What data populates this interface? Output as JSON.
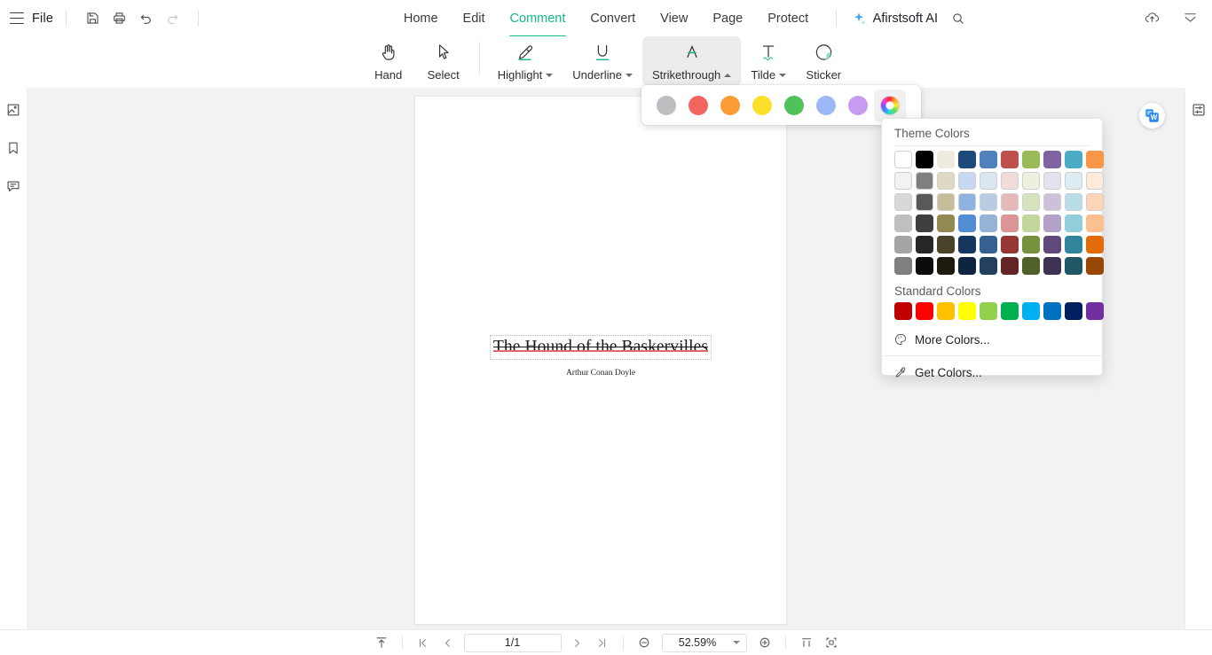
{
  "app": {
    "brand": "Afirstsoft AI",
    "file_menu": "File"
  },
  "menubar": {
    "tabs": [
      {
        "label": "Home",
        "active": false
      },
      {
        "label": "Edit",
        "active": false
      },
      {
        "label": "Comment",
        "active": true
      },
      {
        "label": "Convert",
        "active": false
      },
      {
        "label": "View",
        "active": false
      },
      {
        "label": "Page",
        "active": false
      },
      {
        "label": "Protect",
        "active": false
      }
    ],
    "quick_icons": [
      "save-icon",
      "print-icon",
      "undo-icon",
      "redo-icon"
    ],
    "right_icons": [
      "cloud-upload-icon",
      "collapse-ribbon-icon"
    ],
    "search_icon": "search-icon",
    "ai_icon": "ai-sparkle-icon",
    "active_tab_color": "#12b886"
  },
  "ribbon": {
    "tools": [
      {
        "label": "Hand",
        "icon": "hand-icon",
        "caret": "none",
        "active": false
      },
      {
        "label": "Select",
        "icon": "cursor-arrow-icon",
        "caret": "none",
        "active": false
      },
      {
        "label": "Highlight",
        "icon": "highlight-pen-icon",
        "caret": "down",
        "active": false
      },
      {
        "label": "Underline",
        "icon": "underline-icon",
        "caret": "down",
        "active": false
      },
      {
        "label": "Strikethrough",
        "icon": "strikethrough-icon",
        "caret": "up",
        "active": true
      },
      {
        "label": "Tilde",
        "icon": "tilde-icon",
        "caret": "down",
        "active": false
      },
      {
        "label": "Sticker",
        "icon": "sticker-icon",
        "caret": "none",
        "active": false
      }
    ]
  },
  "swatchbar": {
    "swatches": [
      {
        "name": "gray",
        "hex": "#bcbec2",
        "selected": false
      },
      {
        "name": "red",
        "hex": "#f4645f",
        "selected": false
      },
      {
        "name": "orange",
        "hex": "#fb9c34",
        "selected": false
      },
      {
        "name": "yellow",
        "hex": "#fbdf2b",
        "selected": false
      },
      {
        "name": "green",
        "hex": "#4fc25a",
        "selected": false
      },
      {
        "name": "blue",
        "hex": "#9db8f7",
        "selected": false
      },
      {
        "name": "purple",
        "hex": "#c79cf0",
        "selected": false
      }
    ],
    "wheel": {
      "name": "color-wheel",
      "selected": true
    }
  },
  "colorpanel": {
    "theme_title": "Theme Colors",
    "standard_title": "Standard Colors",
    "theme_rows": [
      [
        "#ffffff",
        "#000000",
        "#eeece1",
        "#1f497d",
        "#4f81bd",
        "#c0504d",
        "#9bbb59",
        "#8064a2",
        "#4bacc6",
        "#f79646"
      ],
      [
        "#f2f2f2",
        "#7f7f7f",
        "#ddd9c3",
        "#c6d9f0",
        "#dbe5f1",
        "#f2dcdb",
        "#ebf1dd",
        "#e5e0ec",
        "#dbeef3",
        "#fdeada"
      ],
      [
        "#d8d8d8",
        "#595959",
        "#c4bd97",
        "#8db3e2",
        "#b8cce4",
        "#e5b9b7",
        "#d7e3bc",
        "#ccc1d9",
        "#b7dde8",
        "#fbd5b5"
      ],
      [
        "#bfbfbf",
        "#3f3f3f",
        "#938953",
        "#548dd4",
        "#95b3d7",
        "#d99694",
        "#c3d69b",
        "#b2a2c7",
        "#92cddc",
        "#fac08f"
      ],
      [
        "#a5a5a5",
        "#262626",
        "#494429",
        "#17365d",
        "#366092",
        "#953734",
        "#76923c",
        "#5f497a",
        "#31859b",
        "#e36c09"
      ],
      [
        "#7f7f7f",
        "#0c0c0c",
        "#1d1b10",
        "#0f243e",
        "#244061",
        "#632423",
        "#4f6128",
        "#3f3151",
        "#205867",
        "#974806"
      ]
    ],
    "standard_row": [
      "#c00000",
      "#ff0000",
      "#ffc000",
      "#ffff00",
      "#92d050",
      "#00b050",
      "#00b0f0",
      "#0070c0",
      "#002060",
      "#7030a0"
    ],
    "more_colors": {
      "label": "More Colors...",
      "icon": "palette-icon"
    },
    "get_colors": {
      "label": "Get Colors...",
      "icon": "eyedropper-icon"
    }
  },
  "leftbar": {
    "items": [
      {
        "name": "page-thumbnails-icon"
      },
      {
        "name": "bookmark-icon"
      },
      {
        "name": "comment-panel-icon"
      }
    ]
  },
  "rightbar": {
    "items": [
      {
        "name": "properties-panel-icon"
      }
    ]
  },
  "document": {
    "title": "The Hound of the Baskervilles",
    "author": "Arthur Conan Doyle",
    "strikethrough_black": "#1d1d1d",
    "strikethrough_red": "#e06868",
    "float_button": "convert-to-word-icon"
  },
  "statusbar": {
    "fit_icon": "fit-page-icon",
    "first_page_icon": "first-page-icon",
    "prev_page_icon": "previous-page-icon",
    "page_value": "1/1",
    "next_page_icon": "next-page-icon",
    "last_page_icon": "last-page-icon",
    "zoom_out_icon": "zoom-out-icon",
    "zoom_value": "52.59%",
    "zoom_in_icon": "zoom-in-icon",
    "single_page_icon": "single-page-view-icon",
    "fit_width_icon": "fit-width-icon"
  }
}
